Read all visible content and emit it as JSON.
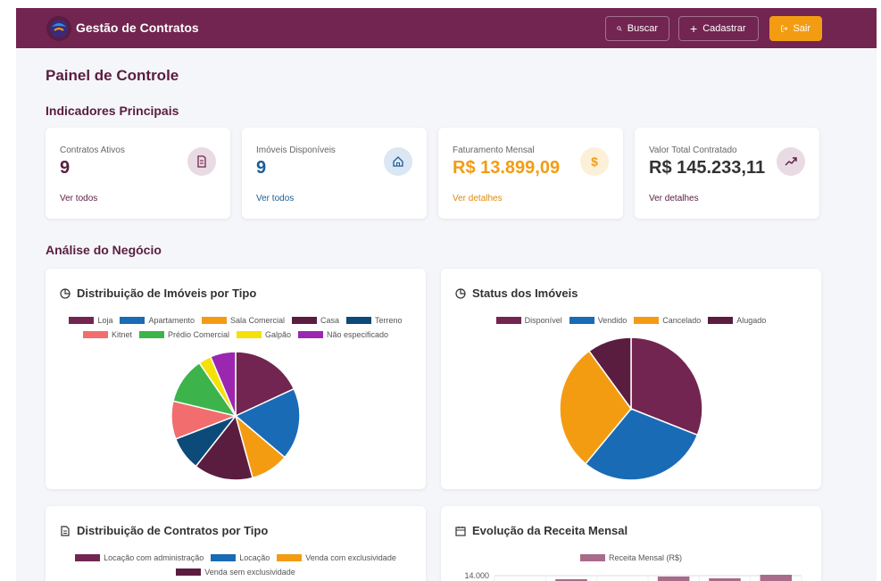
{
  "header": {
    "title": "Gestão de Contratos",
    "search_label": "Buscar",
    "add_label": "Cadastrar",
    "exit_label": "Sair"
  },
  "page": {
    "title": "Painel de Controle",
    "section_indicators": "Indicadores Principais",
    "section_analysis": "Análise do Negócio"
  },
  "kpis": [
    {
      "label": "Contratos Ativos",
      "value": "9",
      "link": "Ver todos",
      "icon": "document-icon",
      "value_color": "#5a1d40",
      "link_color": "#5a1d40"
    },
    {
      "label": "Imóveis Disponíveis",
      "value": "9",
      "link": "Ver todos",
      "icon": "home-icon",
      "value_color": "#1a5e96",
      "link_color": "#1a5e96"
    },
    {
      "label": "Faturamento Mensal",
      "value": "R$ 13.899,09",
      "link": "Ver detalhes",
      "icon": "dollar-icon",
      "value_color": "#f39c12",
      "link_color": "#e08a0b"
    },
    {
      "label": "Valor Total Contratado",
      "value": "R$ 145.233,11",
      "link": "Ver detalhes",
      "icon": "trending-up-icon",
      "value_color": "#333333",
      "link_color": "#5a1d40"
    }
  ],
  "cards": {
    "pie_types_title": "Distribuição de Imóveis por Tipo",
    "pie_status_title": "Status dos Imóveis",
    "contracts_title": "Distribuição de Contratos por Tipo",
    "revenue_title": "Evolução da Receita Mensal"
  },
  "chart_data": [
    {
      "type": "pie",
      "title": "Distribuição de Imóveis por Tipo",
      "categories": [
        "Loja",
        "Apartamento",
        "Sala Comercial",
        "Casa",
        "Terreno",
        "Kitnet",
        "Prédio Comercial",
        "Galpão",
        "Não especificado"
      ],
      "values": [
        17,
        17,
        9,
        14,
        8,
        9,
        11,
        3,
        6
      ],
      "colors": [
        "#722550",
        "#1a6bb5",
        "#f39c12",
        "#5a1d40",
        "#0c4a7a",
        "#f26d6d",
        "#3cb44b",
        "#f5e10a",
        "#9b27b0"
      ],
      "legend": "top"
    },
    {
      "type": "pie",
      "title": "Status dos Imóveis",
      "categories": [
        "Disponível",
        "Vendido",
        "Cancelado",
        "Alugado"
      ],
      "values": [
        31,
        30,
        29,
        10
      ],
      "colors": [
        "#722550",
        "#1a6bb5",
        "#f39c12",
        "#5a1d40"
      ],
      "legend": "top"
    },
    {
      "type": "pie",
      "title": "Distribuição de Contratos por Tipo",
      "categories": [
        "Locação com administração",
        "Locação",
        "Venda com exclusividade",
        "Venda sem exclusividade"
      ],
      "values": [],
      "colors": [
        "#722550",
        "#1a6bb5",
        "#f39c12",
        "#5a1d40"
      ],
      "legend": "top"
    },
    {
      "type": "bar",
      "title": "Evolução da Receita Mensal",
      "series": [
        {
          "name": "Receita Mensal (R$)",
          "values": [
            13200,
            13800,
            13000,
            13950,
            13850,
            14050
          ]
        }
      ],
      "ytick": "14.000",
      "ylim": [
        0,
        14000
      ],
      "color": "#a86b8a",
      "legend": "top"
    }
  ]
}
